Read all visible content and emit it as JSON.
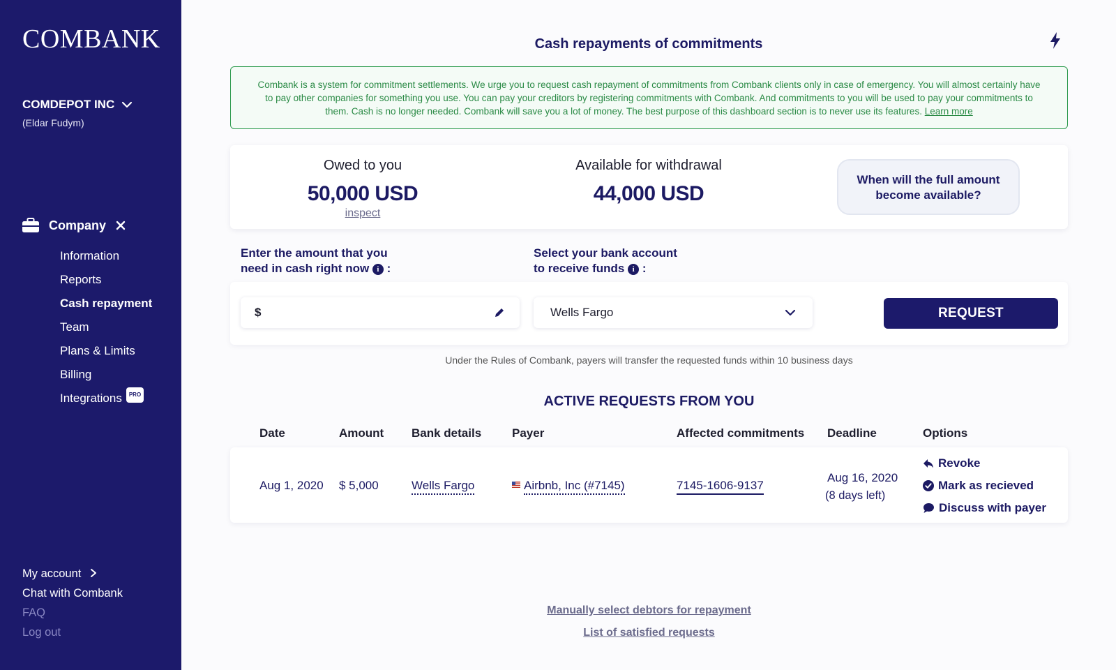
{
  "sidebar": {
    "logo": "COMBANK",
    "company_name": "COMDEPOT INC",
    "company_user": "(Eldar Fudym)",
    "section_label": "Company",
    "nav_items": [
      {
        "label": "Information"
      },
      {
        "label": "Reports"
      },
      {
        "label": "Cash repayment"
      },
      {
        "label": "Team"
      },
      {
        "label": "Plans & Limits"
      },
      {
        "label": "Billing"
      },
      {
        "label": "Integrations",
        "badge": "PRO"
      }
    ],
    "bottom_items": [
      {
        "label": "My account"
      },
      {
        "label": "Chat with Combank"
      },
      {
        "label": "FAQ"
      },
      {
        "label": "Log out"
      }
    ]
  },
  "header": {
    "title": "Cash repayments of commitments"
  },
  "notice": {
    "text": "Combank is a system for commitment settlements. We urge you to request cash repayment of commitments from Combank clients only in case of emergency. You will almost certainly have to pay other companies for something you use. You can pay your creditors by registering commitments with Combank. And commitments to you will be used to pay your commitments to them. Cash is no longer needed. Combank will save you a lot of money. The best purpose of this dashboard section is to never use its features.",
    "link": "Learn more"
  },
  "stats": {
    "owed_label": "Owed to you",
    "owed_value": "50,000 USD",
    "owed_link": "inspect",
    "available_label": "Available for withdrawal",
    "available_value": "44,000 USD",
    "when_button": "When will the full amount become available?"
  },
  "form": {
    "amount_label_1": "Enter the amount that you",
    "amount_label_2": "need in cash right now",
    "bank_label_1": "Select your bank account",
    "bank_label_2": "to receive funds",
    "currency_symbol": "$",
    "amount_value": "",
    "bank_selected": "Wells Fargo",
    "request_button": "REQUEST",
    "rules_note": "Under the Rules of Combank, payers will transfer the requested funds within 10 business days"
  },
  "requests": {
    "title": "ACTIVE REQUESTS FROM YOU",
    "columns": [
      "Date",
      "Amount",
      "Bank details",
      "Payer",
      "Affected commitments",
      "Deadline",
      "Options"
    ],
    "rows": [
      {
        "date": "Aug 1, 2020",
        "amount": "$ 5,000",
        "bank": "Wells Fargo",
        "payer": "Airbnb, Inc (#7145)",
        "commitment": "7145-1606-9137",
        "deadline": "Aug 16, 2020",
        "days_left": "(8 days left)",
        "options": [
          "Revoke",
          "Mark as recieved",
          "Discuss with payer"
        ]
      }
    ]
  },
  "footer_links": {
    "manual": "Manually select debtors for repayment",
    "satisfied": "List of satisfied requests"
  }
}
